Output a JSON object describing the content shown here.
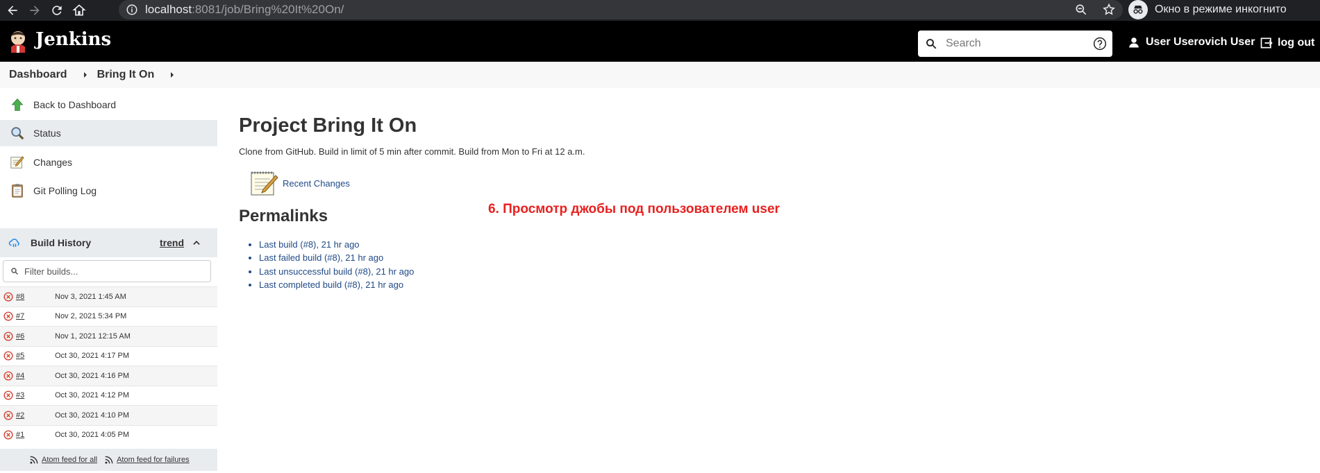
{
  "browser": {
    "url_host": "localhost",
    "url_rest": ":8081/job/Bring%20It%20On/",
    "incognito_label": "Окно в режиме инкогнито"
  },
  "header": {
    "app_title": "Jenkins",
    "search_placeholder": "Search",
    "user_name": "User Userovich User",
    "logout_label": "log out"
  },
  "breadcrumb": {
    "items": [
      "Dashboard",
      "Bring It On"
    ]
  },
  "sidebar": {
    "tasks": [
      {
        "label": "Back to Dashboard",
        "icon": "up-arrow-icon"
      },
      {
        "label": "Status",
        "icon": "magnifier-icon"
      },
      {
        "label": "Changes",
        "icon": "notepad-icon"
      },
      {
        "label": "Git Polling Log",
        "icon": "clipboard-icon"
      }
    ],
    "build_history": {
      "title": "Build History",
      "trend_label": "trend",
      "filter_placeholder": "Filter builds...",
      "builds": [
        {
          "number": "#8",
          "date": "Nov 3, 2021 1:45 AM"
        },
        {
          "number": "#7",
          "date": "Nov 2, 2021 5:34 PM"
        },
        {
          "number": "#6",
          "date": "Nov 1, 2021 12:15 AM"
        },
        {
          "number": "#5",
          "date": "Oct 30, 2021 4:17 PM"
        },
        {
          "number": "#4",
          "date": "Oct 30, 2021 4:16 PM"
        },
        {
          "number": "#3",
          "date": "Oct 30, 2021 4:12 PM"
        },
        {
          "number": "#2",
          "date": "Oct 30, 2021 4:10 PM"
        },
        {
          "number": "#1",
          "date": "Oct 30, 2021 4:05 PM"
        }
      ],
      "feed_all": "Atom feed for all",
      "feed_failures": "Atom feed for failures"
    }
  },
  "main": {
    "title": "Project Bring It On",
    "description": "Clone from GitHub. Build in limit of 5 min after commit. Build from Mon to Fri at 12 a.m.",
    "recent_changes": "Recent Changes",
    "permalinks_title": "Permalinks",
    "permalinks": [
      "Last build (#8), 21 hr ago",
      "Last failed build (#8), 21 hr ago",
      "Last unsuccessful build (#8), 21 hr ago",
      "Last completed build (#8), 21 hr ago"
    ],
    "note": "6. Просмотр джобы под пользователем user"
  }
}
